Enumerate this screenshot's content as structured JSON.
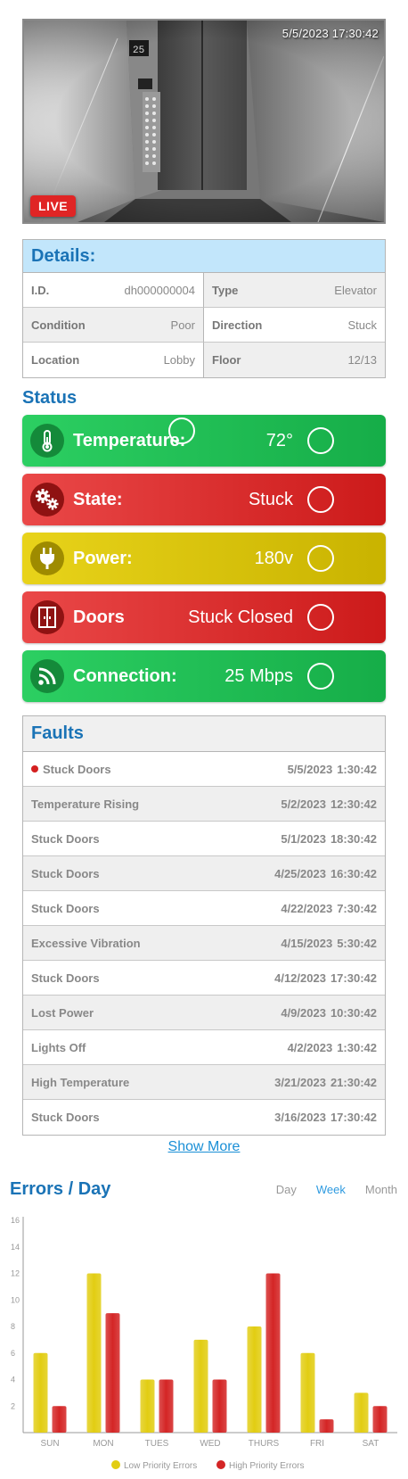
{
  "camera": {
    "timestamp": "5/5/2023 17:30:42",
    "live_label": "LIVE",
    "floor_display": "25"
  },
  "details": {
    "title": "Details:",
    "fields": [
      {
        "key": "I.D.",
        "value": "dh000000004"
      },
      {
        "key": "Type",
        "value": "Elevator"
      },
      {
        "key": "Condition",
        "value": "Poor"
      },
      {
        "key": "Direction",
        "value": "Stuck"
      },
      {
        "key": "Location",
        "value": "Lobby"
      },
      {
        "key": "Floor",
        "value": "12/13"
      }
    ]
  },
  "status": {
    "title": "Status",
    "items": [
      {
        "label": "Temperature:",
        "value": "72°",
        "color": "green",
        "icon": "thermometer-icon"
      },
      {
        "label": "State:",
        "value": "Stuck",
        "color": "red",
        "icon": "gears-icon"
      },
      {
        "label": "Power:",
        "value": "180v",
        "color": "yellow",
        "icon": "plug-icon"
      },
      {
        "label": "Doors",
        "value": "Stuck Closed",
        "color": "red",
        "icon": "doors-icon"
      },
      {
        "label": "Connection:",
        "value": "25 Mbps",
        "color": "green",
        "icon": "signal-icon"
      }
    ]
  },
  "faults": {
    "title": "Faults",
    "rows": [
      {
        "name": "Stuck Doors",
        "date": "5/5/2023",
        "time": "1:30:42",
        "active": true
      },
      {
        "name": "Temperature Rising",
        "date": "5/2/2023",
        "time": "12:30:42",
        "active": false
      },
      {
        "name": "Stuck Doors",
        "date": "5/1/2023",
        "time": "18:30:42",
        "active": false
      },
      {
        "name": "Stuck Doors",
        "date": "4/25/2023",
        "time": "16:30:42",
        "active": false
      },
      {
        "name": "Stuck Doors",
        "date": "4/22/2023",
        "time": "7:30:42",
        "active": false
      },
      {
        "name": "Excessive Vibration",
        "date": "4/15/2023",
        "time": "5:30:42",
        "active": false
      },
      {
        "name": "Stuck Doors",
        "date": "4/12/2023",
        "time": "17:30:42",
        "active": false
      },
      {
        "name": "Lost Power",
        "date": "4/9/2023",
        "time": "10:30:42",
        "active": false
      },
      {
        "name": "Lights Off",
        "date": "4/2/2023",
        "time": "1:30:42",
        "active": false
      },
      {
        "name": "High Temperature",
        "date": "3/21/2023",
        "time": "21:30:42",
        "active": false
      },
      {
        "name": "Stuck Doors",
        "date": "3/16/2023",
        "time": "17:30:42",
        "active": false
      }
    ],
    "show_more_label": "Show More"
  },
  "errors_chart": {
    "title": "Errors / Day",
    "tabs": [
      "Day",
      "Week",
      "Month"
    ],
    "active_tab": "Week"
  },
  "chart_data": {
    "type": "bar",
    "title": "Errors / Day",
    "categories": [
      "SUN",
      "MON",
      "TUES",
      "WED",
      "THURS",
      "FRI",
      "SAT"
    ],
    "series": [
      {
        "name": "Low Priority Errors",
        "color": "#e2cd12",
        "values": [
          6,
          12,
          4,
          7,
          8,
          6,
          3
        ]
      },
      {
        "name": "High Priority Errors",
        "color": "#d42525",
        "values": [
          2,
          9,
          4,
          4,
          12,
          1,
          2
        ]
      }
    ],
    "ylim": [
      0,
      16
    ],
    "yticks": [
      2,
      4,
      6,
      8,
      10,
      12,
      14,
      16
    ],
    "legend": "bottom"
  }
}
